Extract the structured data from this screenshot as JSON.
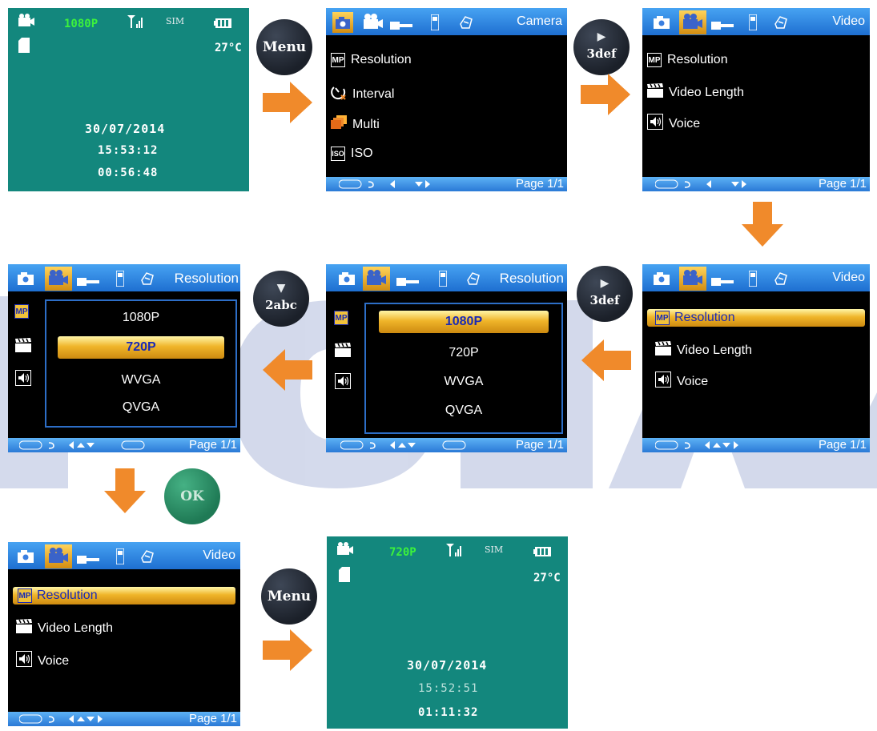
{
  "key_menu": "Menu",
  "key_right": "3def",
  "key_down": "2abc",
  "key_ok": "OK",
  "status1": {
    "resolution": "1080P",
    "sim": "SIM",
    "temperature": "27°C",
    "date": "30/07/2014",
    "time": "15:53:12",
    "counter": "00:56:48"
  },
  "status2": {
    "resolution": "720P",
    "sim": "SIM",
    "temperature": "27°C",
    "date": "30/07/2014",
    "time": "15:52:51",
    "counter": "01:11:32"
  },
  "camera_menu": {
    "title": "Camera",
    "items": [
      {
        "label": "Resolution",
        "icon": "mp-icon"
      },
      {
        "label": "Interval",
        "icon": "timer-icon"
      },
      {
        "label": "Multi",
        "icon": "multi-shot-icon"
      },
      {
        "label": "ISO",
        "icon": "iso-icon"
      }
    ],
    "page": "Page 1/1"
  },
  "video_menu": {
    "title": "Video",
    "items": [
      {
        "label": "Resolution",
        "icon": "mp-icon"
      },
      {
        "label": "Video Length",
        "icon": "clapper-icon"
      },
      {
        "label": "Voice",
        "icon": "speaker-icon"
      }
    ],
    "page": "Page 1/1"
  },
  "resolution_menu": {
    "title": "Resolution",
    "options": [
      "1080P",
      "720P",
      "WVGA",
      "QVGA"
    ],
    "ok": "OK",
    "page": "Page 1/1"
  },
  "watermark_colors": {
    "fill": "#3d55a8"
  }
}
